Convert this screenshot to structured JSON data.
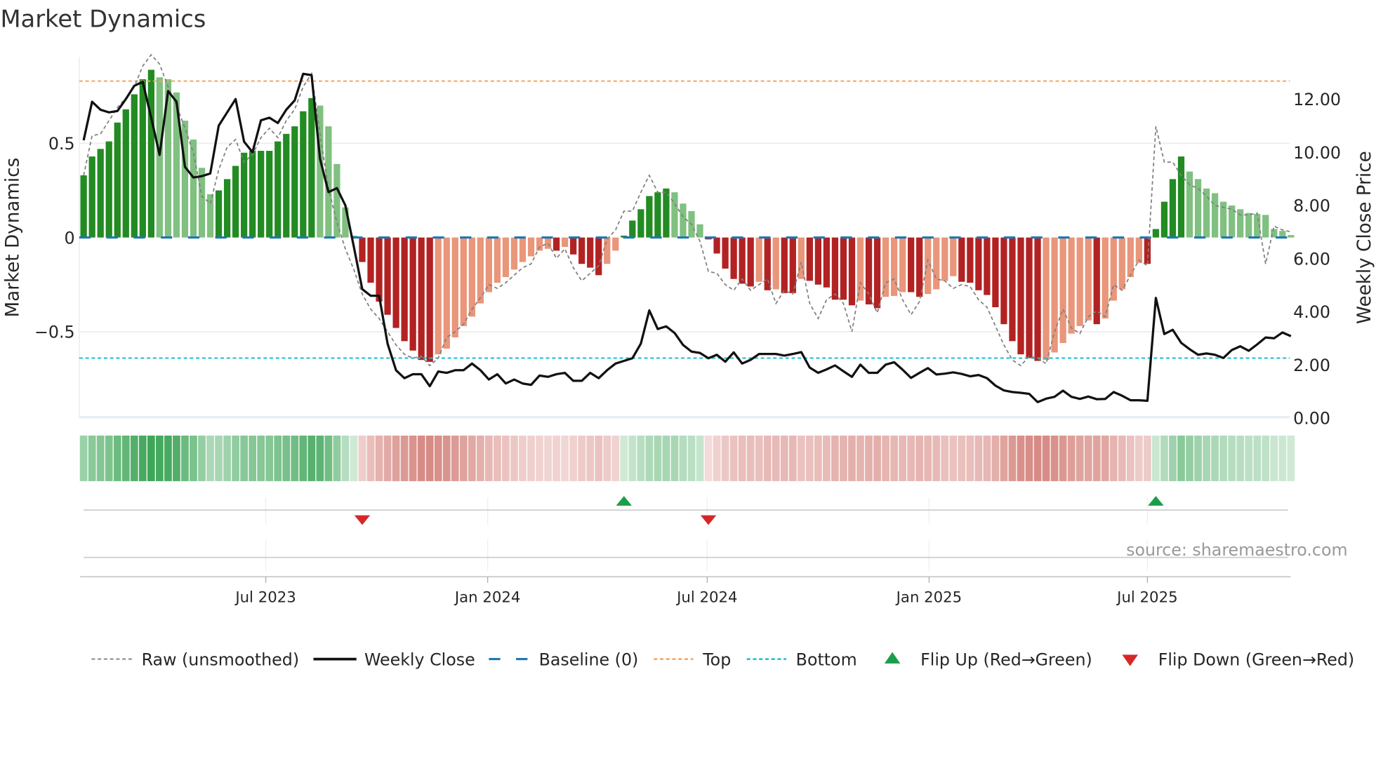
{
  "chart_data": {
    "type": "bar",
    "title": "Market Dynamics",
    "ylabel": "Market Dynamics",
    "y2label": "Weekly Close Price",
    "ylim": [
      -0.95,
      0.96
    ],
    "y2lim": [
      0,
      13.5
    ],
    "yticks": [
      {
        "v": 0.5,
        "label": "0.5"
      },
      {
        "v": 0,
        "label": "0"
      },
      {
        "v": -0.5,
        "label": "−0.5"
      }
    ],
    "y2ticks": [
      {
        "v": 0,
        "label": "0.00"
      },
      {
        "v": 2,
        "label": "2.00"
      },
      {
        "v": 4,
        "label": "4.00"
      },
      {
        "v": 6,
        "label": "6.00"
      },
      {
        "v": 8,
        "label": "8.00"
      },
      {
        "v": 10,
        "label": "10.00"
      },
      {
        "v": 12,
        "label": "12.00"
      }
    ],
    "x_start": "2023-01-31",
    "interval_days": 7,
    "xticks": [
      {
        "label": "Jul 2023",
        "date": "2023-07-01"
      },
      {
        "label": "Jan 2024",
        "date": "2024-01-01"
      },
      {
        "label": "Jul 2024",
        "date": "2024-07-01"
      },
      {
        "label": "Jan 2025",
        "date": "2025-01-01"
      },
      {
        "label": "Jul 2025",
        "date": "2025-07-01"
      }
    ],
    "top_level": 0.83,
    "bottom_level": -0.64,
    "baseline": 0,
    "values": [
      0.33,
      0.43,
      0.47,
      0.51,
      0.61,
      0.68,
      0.76,
      0.84,
      0.89,
      0.85,
      0.84,
      0.77,
      0.62,
      0.52,
      0.37,
      0.23,
      0.25,
      0.31,
      0.38,
      0.45,
      0.46,
      0.46,
      0.46,
      0.51,
      0.55,
      0.59,
      0.67,
      0.74,
      0.7,
      0.59,
      0.39,
      0.16,
      0.01,
      -0.13,
      -0.24,
      -0.34,
      -0.41,
      -0.48,
      -0.55,
      -0.6,
      -0.65,
      -0.66,
      -0.62,
      -0.59,
      -0.53,
      -0.47,
      -0.42,
      -0.35,
      -0.29,
      -0.24,
      -0.21,
      -0.17,
      -0.13,
      -0.1,
      -0.07,
      -0.06,
      -0.07,
      -0.05,
      -0.09,
      -0.14,
      -0.16,
      -0.2,
      -0.14,
      -0.07,
      0.01,
      0.09,
      0.15,
      0.22,
      0.24,
      0.26,
      0.24,
      0.18,
      0.14,
      0.07,
      -0.01,
      -0.085,
      -0.165,
      -0.22,
      -0.245,
      -0.26,
      -0.235,
      -0.28,
      -0.275,
      -0.295,
      -0.295,
      -0.22,
      -0.23,
      -0.25,
      -0.265,
      -0.33,
      -0.33,
      -0.36,
      -0.335,
      -0.355,
      -0.375,
      -0.315,
      -0.31,
      -0.29,
      -0.29,
      -0.315,
      -0.3,
      -0.275,
      -0.23,
      -0.205,
      -0.235,
      -0.24,
      -0.28,
      -0.305,
      -0.37,
      -0.46,
      -0.55,
      -0.62,
      -0.64,
      -0.655,
      -0.65,
      -0.61,
      -0.56,
      -0.51,
      -0.47,
      -0.44,
      -0.46,
      -0.43,
      -0.335,
      -0.275,
      -0.21,
      -0.135,
      -0.14,
      0.045,
      0.19,
      0.31,
      0.43,
      0.35,
      0.31,
      0.26,
      0.235,
      0.19,
      0.17,
      0.15,
      0.13,
      0.125,
      0.12,
      0.045,
      0.035,
      0.013
    ],
    "raw": [
      0.33,
      0.54,
      0.55,
      0.62,
      0.69,
      0.74,
      0.8,
      0.91,
      0.97,
      0.92,
      0.8,
      0.7,
      0.58,
      0.45,
      0.22,
      0.18,
      0.36,
      0.48,
      0.52,
      0.4,
      0.44,
      0.53,
      0.58,
      0.53,
      0.62,
      0.68,
      0.8,
      0.87,
      0.55,
      0.26,
      0.08,
      -0.06,
      -0.17,
      -0.3,
      -0.38,
      -0.43,
      -0.5,
      -0.57,
      -0.62,
      -0.64,
      -0.63,
      -0.68,
      -0.64,
      -0.53,
      -0.5,
      -0.46,
      -0.38,
      -0.32,
      -0.25,
      -0.27,
      -0.24,
      -0.2,
      -0.16,
      -0.14,
      -0.05,
      -0.03,
      -0.11,
      -0.06,
      -0.16,
      -0.23,
      -0.19,
      -0.15,
      -0.01,
      0.04,
      0.14,
      0.14,
      0.24,
      0.33,
      0.24,
      0.24,
      0.18,
      0.11,
      0.07,
      -0.02,
      -0.18,
      -0.19,
      -0.25,
      -0.28,
      -0.22,
      -0.28,
      -0.25,
      -0.22,
      -0.35,
      -0.28,
      -0.3,
      -0.13,
      -0.35,
      -0.43,
      -0.33,
      -0.3,
      -0.35,
      -0.5,
      -0.24,
      -0.3,
      -0.4,
      -0.24,
      -0.22,
      -0.33,
      -0.41,
      -0.34,
      -0.12,
      -0.22,
      -0.23,
      -0.27,
      -0.25,
      -0.26,
      -0.33,
      -0.37,
      -0.47,
      -0.57,
      -0.65,
      -0.68,
      -0.63,
      -0.64,
      -0.67,
      -0.5,
      -0.38,
      -0.48,
      -0.51,
      -0.42,
      -0.39,
      -0.42,
      -0.25,
      -0.28,
      -0.2,
      -0.12,
      -0.15,
      0.59,
      0.4,
      0.4,
      0.33,
      0.28,
      0.26,
      0.22,
      0.17,
      0.16,
      0.15,
      0.12,
      0.12,
      0.13,
      -0.14,
      0.06,
      0.04,
      0.03
    ],
    "close": [
      10.45,
      11.9,
      11.6,
      11.5,
      11.55,
      12.0,
      12.5,
      12.65,
      11.3,
      9.9,
      12.3,
      11.9,
      9.45,
      9.05,
      9.1,
      9.2,
      11.0,
      11.5,
      12.0,
      10.4,
      10.0,
      11.2,
      11.3,
      11.1,
      11.6,
      11.95,
      12.95,
      12.9,
      9.75,
      8.5,
      8.65,
      8.0,
      6.45,
      4.85,
      4.6,
      4.6,
      2.8,
      1.8,
      1.5,
      1.65,
      1.65,
      1.2,
      1.75,
      1.7,
      1.8,
      1.8,
      2.05,
      1.8,
      1.45,
      1.65,
      1.3,
      1.45,
      1.3,
      1.25,
      1.6,
      1.55,
      1.65,
      1.7,
      1.4,
      1.4,
      1.7,
      1.5,
      1.8,
      2.05,
      2.15,
      2.25,
      2.8,
      4.05,
      3.35,
      3.45,
      3.2,
      2.75,
      2.5,
      2.45,
      2.25,
      2.38,
      2.12,
      2.47,
      2.05,
      2.19,
      2.41,
      2.41,
      2.41,
      2.35,
      2.41,
      2.48,
      1.9,
      1.7,
      1.83,
      1.98,
      1.76,
      1.55,
      2.01,
      1.7,
      1.7,
      2.01,
      2.1,
      1.82,
      1.51,
      1.7,
      1.88,
      1.64,
      1.67,
      1.72,
      1.66,
      1.57,
      1.62,
      1.5,
      1.22,
      1.04,
      0.98,
      0.95,
      0.91,
      0.6,
      0.73,
      0.8,
      1.03,
      0.8,
      0.72,
      0.81,
      0.71,
      0.72,
      0.98,
      0.84,
      0.67,
      0.67,
      0.65,
      4.52,
      3.16,
      3.32,
      2.83,
      2.59,
      2.38,
      2.43,
      2.38,
      2.26,
      2.56,
      2.7,
      2.53,
      2.77,
      3.03,
      3.0,
      3.22,
      3.08
    ],
    "flips": [
      {
        "type": "down",
        "index": 33
      },
      {
        "type": "up",
        "index": 64
      },
      {
        "type": "down",
        "index": 74
      },
      {
        "type": "up",
        "index": 127
      }
    ],
    "legend": {
      "placement": "bottom",
      "items": [
        {
          "key": "raw",
          "label": "Raw (unsmoothed)"
        },
        {
          "key": "close",
          "label": "Weekly Close"
        },
        {
          "key": "baseline",
          "label": "Baseline (0)"
        },
        {
          "key": "top",
          "label": "Top"
        },
        {
          "key": "bottom",
          "label": "Bottom"
        },
        {
          "key": "flip_up",
          "label": "Flip Up (Red→Green)"
        },
        {
          "key": "flip_down",
          "label": "Flip Down (Green→Red)"
        }
      ]
    },
    "source": "source: sharemaestro.com",
    "colors": {
      "green_strong": "#228b22",
      "green_weak": "#80c080",
      "red_strong": "#b22222",
      "red_weak": "#e9967a",
      "heat_green": "#2e9e4a",
      "heat_red": "#c9625a",
      "baseline": "#1f77b4",
      "top": "#f4a460",
      "bottom": "#17becf",
      "raw": "#808080",
      "close": "#111111",
      "flip_up": "#1a9e4a",
      "flip_down": "#d62728"
    }
  }
}
